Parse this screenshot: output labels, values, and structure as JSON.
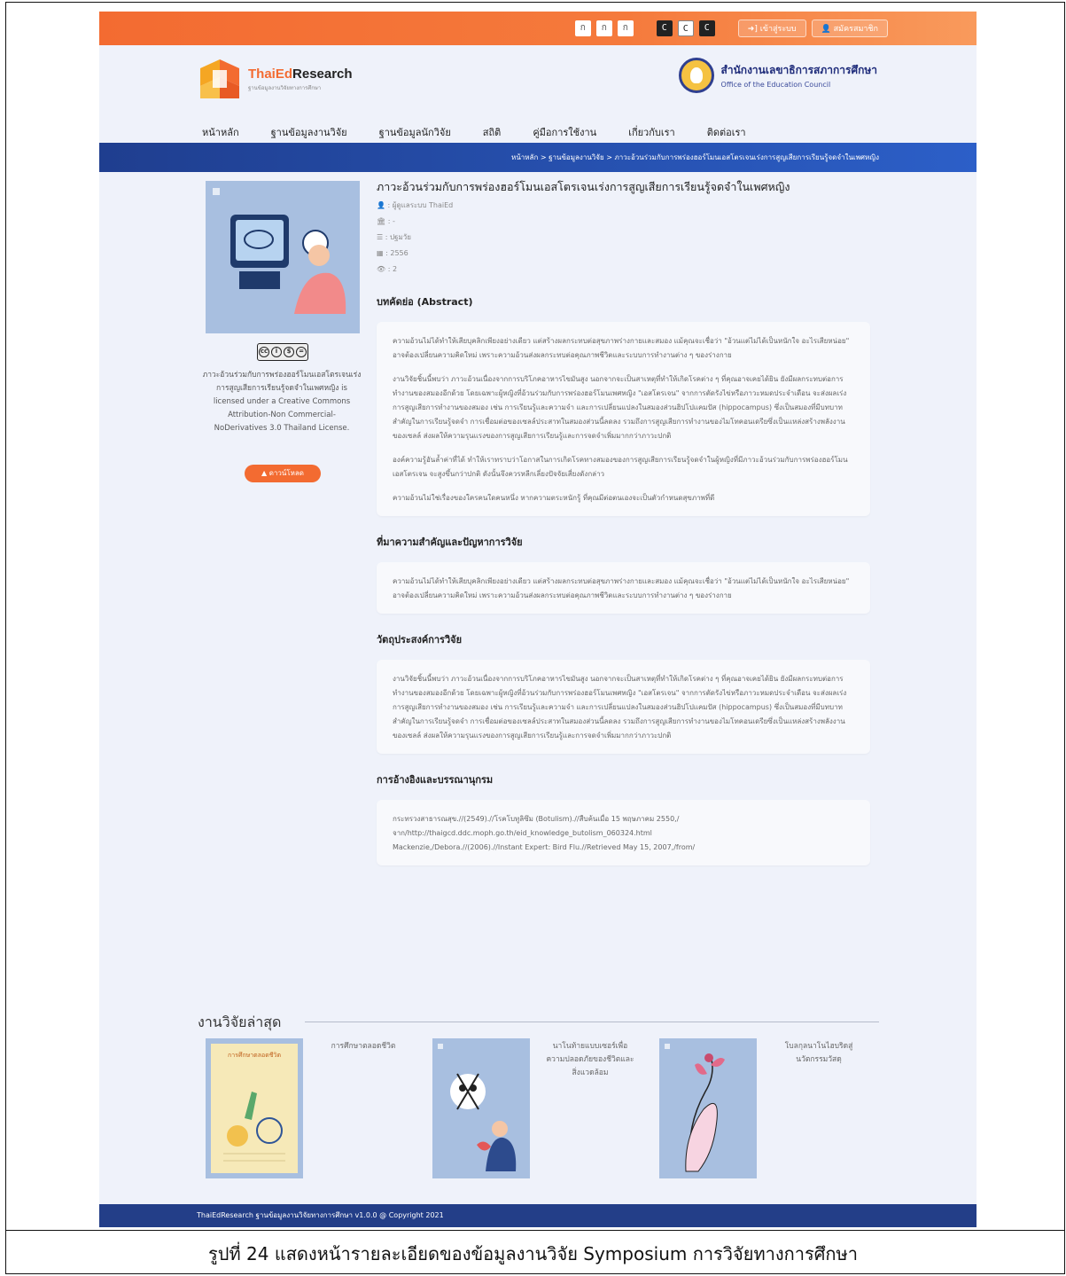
{
  "topbar": {
    "font_buttons": [
      "ก",
      "ก",
      "ก"
    ],
    "contrast_buttons": [
      "C",
      "C",
      "C"
    ],
    "login_label": "เข้าสู่ระบบ",
    "register_label": "สมัครสมาชิก"
  },
  "header": {
    "logo_name_left": "ThaiEd",
    "logo_name_right": "Research",
    "logo_sub": "ฐานข้อมูลงานวิจัยทางการศึกษา",
    "agency_th": "สำนักงานเลขาธิการสภาการศึกษา",
    "agency_en": "Office of the Education Council"
  },
  "nav": [
    "หน้าหลัก",
    "ฐานข้อมูลงานวิจัย",
    "ฐานข้อมูลนักวิจัย",
    "สถิติ",
    "คู่มือการใช้งาน",
    "เกี่ยวกับเรา",
    "ติดต่อเรา"
  ],
  "breadcrumb": "หน้าหลัก > ฐานข้อมูลงานวิจัย > ภาวะอ้วนร่วมกับการพร่องฮอร์โมนเอสโตรเจนเร่งการสูญเสียการเรียนรู้จดจำในเพศหญิง",
  "research": {
    "title": "ภาวะอ้วนร่วมกับการพร่องฮอร์โมนเอสโตรเจนเร่งการสูญเสียการเรียนรู้จดจำในเพศหญิง",
    "author": ": ผู้ดูแลระบบ ThaiEd",
    "institution": ": -",
    "type": ": ปฐมวัย",
    "year": ": 2556",
    "views": ": 2"
  },
  "sidebar": {
    "license_text": "ภาวะอ้วนร่วมกับการพร่องฮอร์โมนเอสโตรเจนเร่งการสูญเสียการเรียนรู้จดจำในเพศหญิง is licensed under a Creative Commons Attribution-Non Commercial-NoDerivatives 3.0 Thailand License.",
    "download_label": "ดาวน์โหลด"
  },
  "sections": {
    "abstract_h": "บทคัดย่อ (Abstract)",
    "abstract_p1": "ความอ้วนไม่ได้ทำให้เสียบุคลิกเพียงอย่างเดียว แต่สร้างผลกระทบต่อสุขภาพร่างกายและสมอง แม้คุณจะเชื่อว่า \"อ้วนแต่ไม่ได้เป็นหนักใจ อะไรเสียหน่อย\" อาจต้องเปลี่ยนความคิดใหม่ เพราะความอ้วนส่งผลกระทบต่อคุณภาพชีวิตและระบบการทำงานต่าง ๆ ของร่างกาย",
    "abstract_p2": "งานวิจัยชิ้นนี้พบว่า ภาวะอ้วนเนื่องจากการบริโภคอาหารไขมันสูง นอกจากจะเป็นสาเหตุที่ทำให้เกิดโรคต่าง ๆ ที่คุณอาจเคยได้ยิน ยังมีผลกระทบต่อการทำงานของสมองอีกด้วย โดยเฉพาะผู้หญิงที่อ้วนร่วมกับการพร่องฮอร์โมนเพศหญิง \"เอสโตรเจน\" จากการตัดรังไข่หรือภาวะหมดประจำเดือน จะส่งผลเร่งการสูญเสียการทำงานของสมอง เช่น การเรียนรู้และความจำ และการเปลี่ยนแปลงในสมองส่วนฮิปโปแคมปัส (hippocampus) ซึ่งเป็นสมองที่มีบทบาทสำคัญในการเรียนรู้จดจำ การเชื่อมต่อของเซลล์ประสาทในสมองส่วนนี้ลดลง รวมถึงการสูญเสียการทำงานของไมโทคอนเดรียซึ่งเป็นแหล่งสร้างพลังงานของเซลล์ ส่งผลให้ความรุนแรงของการสูญเสียการเรียนรู้และการจดจำเพิ่มมากกว่าภาวะปกติ",
    "abstract_p3": "องค์ความรู้อันล้ำค่าที่ได้ ทำให้เราทราบว่าโอกาสในการเกิดโรคทางสมองของการสูญเสียการเรียนรู้จดจำในผู้หญิงที่มีภาวะอ้วนร่วมกับการพร่องฮอร์โมนเอสโตรเจน จะสูงขึ้นกว่าปกติ ดังนั้นจึงควรหลีกเลี่ยงปัจจัยเสี่ยงดังกล่าว",
    "abstract_p4": "ความอ้วนไม่ใช่เรื่องของใครคนใดคนหนึ่ง หากความตระหนักรู้ ที่คุณมีต่อตนเองจะเป็นตัวกำหนดสุขภาพที่ดี",
    "background_h": "ที่มาความสำคัญและปัญหาการวิจัย",
    "background_p": "ความอ้วนไม่ได้ทำให้เสียบุคลิกเพียงอย่างเดียว แต่สร้างผลกระทบต่อสุขภาพร่างกายและสมอง แม้คุณจะเชื่อว่า \"อ้วนแต่ไม่ได้เป็นหนักใจ อะไรเสียหน่อย\" อาจต้องเปลี่ยนความคิดใหม่ เพราะความอ้วนส่งผลกระทบต่อคุณภาพชีวิตและระบบการทำงานต่าง ๆ ของร่างกาย",
    "objective_h": "วัตถุประสงค์การวิจัย",
    "objective_p": "งานวิจัยชิ้นนี้พบว่า ภาวะอ้วนเนื่องจากการบริโภคอาหารไขมันสูง นอกจากจะเป็นสาเหตุที่ทำให้เกิดโรคต่าง ๆ ที่คุณอาจเคยได้ยิน ยังมีผลกระทบต่อการทำงานของสมองอีกด้วย โดยเฉพาะผู้หญิงที่อ้วนร่วมกับการพร่องฮอร์โมนเพศหญิง \"เอสโตรเจน\" จากการตัดรังไข่หรือภาวะหมดประจำเดือน จะส่งผลเร่งการสูญเสียการทำงานของสมอง เช่น การเรียนรู้และความจำ และการเปลี่ยนแปลงในสมองส่วนฮิปโปแคมปัส (hippocampus) ซึ่งเป็นสมองที่มีบทบาทสำคัญในการเรียนรู้จดจำ การเชื่อมต่อของเซลล์ประสาทในสมองส่วนนี้ลดลง รวมถึงการสูญเสียการทำงานของไมโทคอนเดรียซึ่งเป็นแหล่งสร้างพลังงานของเซลล์ ส่งผลให้ความรุนแรงของการสูญเสียการเรียนรู้และการจดจำเพิ่มมากกว่าภาวะปกติ",
    "reference_h": "การอ้างอิงและบรรณานุกรม",
    "reference_1": "กระทรวงสาธารณสุข.//(2549).//โรคโบทูลิซึม (Botulism).//สืบค้นเมื่อ 15 พฤษภาคม 2550,/",
    "reference_2": "จาก/http://thaigcd.ddc.moph.go.th/eid_knowledge_butolism_060324.html",
    "reference_3": "Mackenzie,/Debora.//(2006).//Instant Expert: Bird Flu.//Retrieved May 15, 2007,/from/"
  },
  "latest": {
    "heading": "งานวิจัยล่าสุด",
    "items": [
      {
        "cover_text": "การศึกษาตลอดชีวิต",
        "caption": "การศึกษาตลอดชีวิต"
      },
      {
        "caption": "นาโนท้ายแบบเซอร์เพื่อความปลอดภัยของชีวิตและสิ่งแวดล้อม"
      },
      {
        "caption": "โบลกุลนาโนไฮบริดสู่นวัตกรรมวัสดุ"
      }
    ]
  },
  "footer": "ThaiEdResearch ฐานข้อมูลงานวิจัยทางการศึกษา v1.0.0 @ Copyright 2021",
  "caption": "รูปที่ 24 แสดงหน้ารายละเอียดของข้อมูลงานวิจัย Symposium การวิจัยทางการศึกษา",
  "colors": {
    "accent": "#f36b31",
    "navy": "#233e88",
    "panel": "#eff2fa",
    "cover": "#a8bfe0"
  }
}
